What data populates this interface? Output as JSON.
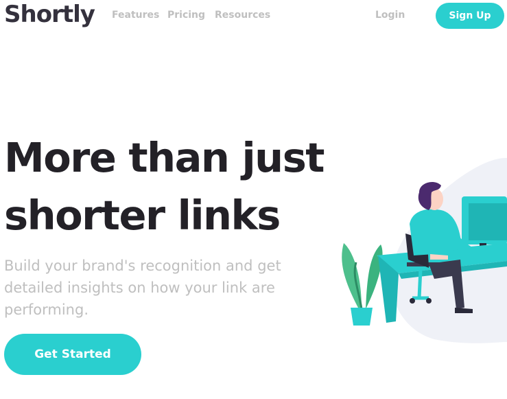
{
  "brand": {
    "logo": "Shortly"
  },
  "nav": {
    "links": [
      "Features",
      "Pricing",
      "Resources"
    ],
    "login": "Login",
    "signup": "Sign Up"
  },
  "hero": {
    "title": "More than just shorter links",
    "subtitle": "Build your brand's recognition and get detailed insights on how your link are performing.",
    "cta": "Get Started"
  },
  "colors": {
    "primary": "#2acfcf",
    "text_dark": "#232127",
    "text_muted": "#bfbfbf",
    "blob": "#eff1f7"
  },
  "illustration": {
    "name": "working-person-illustration"
  }
}
